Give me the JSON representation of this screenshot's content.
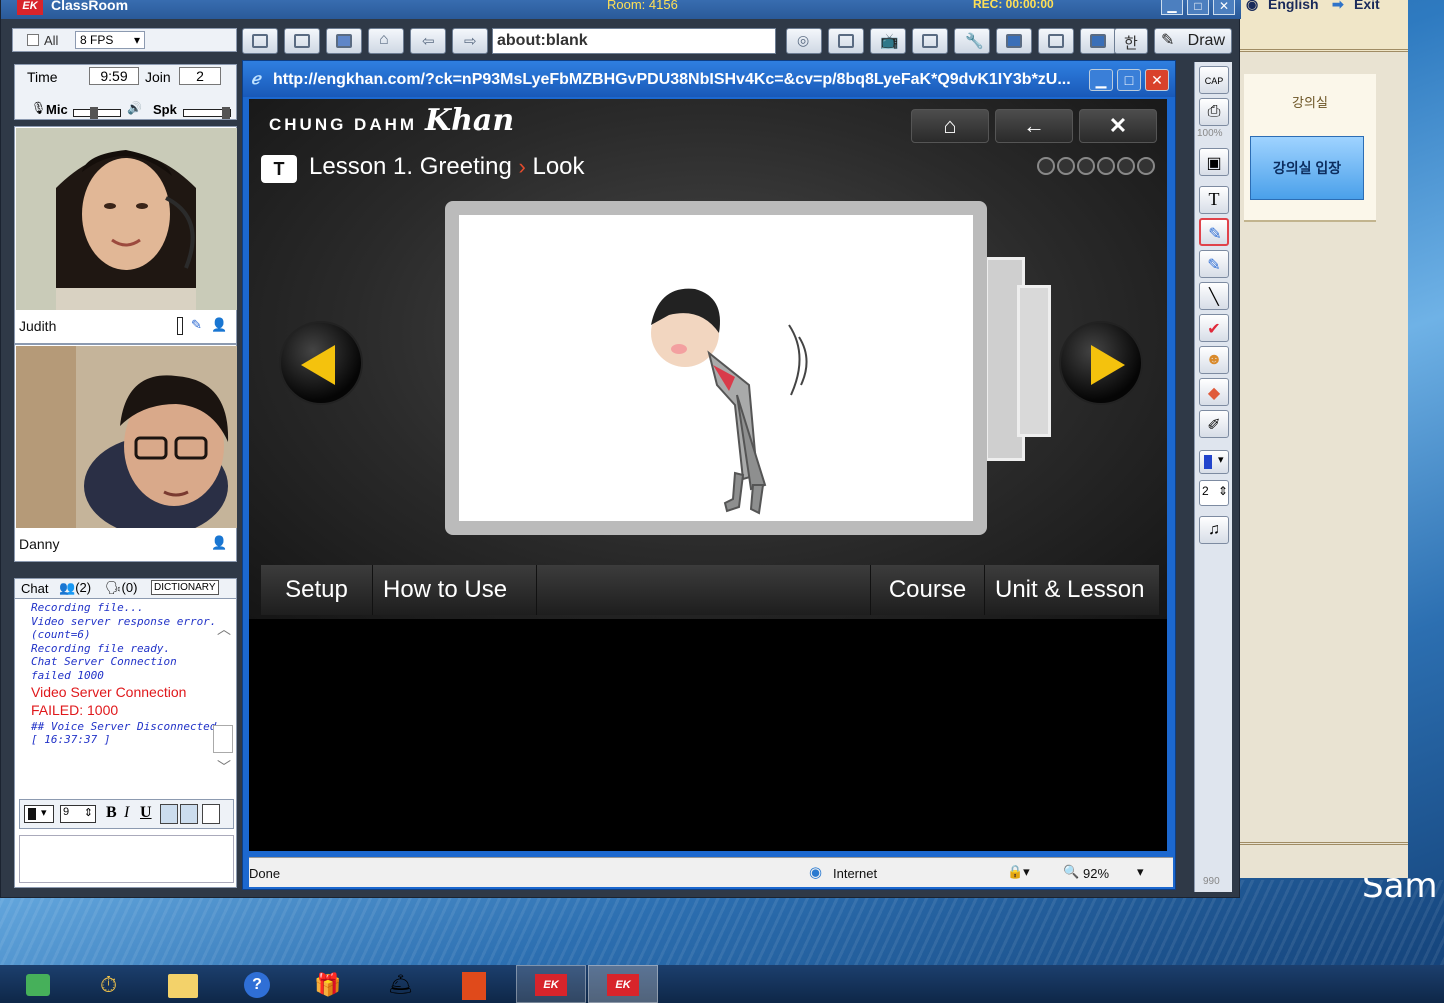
{
  "window": {
    "app_title": "ClassRoom",
    "room": "Room: 4156",
    "rec": "REC: 00:00:00",
    "app_logo": "EK"
  },
  "side_page": {
    "english_link": "English",
    "exit_link": "Exit",
    "panel_title": "강의실",
    "enter_button": "강의실 입장"
  },
  "desktop_text": "Sam",
  "controls": {
    "all_label": "All",
    "fps": "8 FPS",
    "time_label": "Time",
    "time_value": "9:59",
    "join_label": "Join",
    "join_value": "2",
    "mic_label": "Mic",
    "spk_label": "Spk"
  },
  "participants": [
    {
      "name": "Judith"
    },
    {
      "name": "Danny"
    }
  ],
  "chat": {
    "tab_chat": "Chat",
    "tab_users": "(2)",
    "tab_speakers": "(0)",
    "dictionary": "DICTIONARY",
    "log": [
      {
        "text": "Recording file...",
        "style": "mono"
      },
      {
        "text": "Video server response error.  (count=6)",
        "style": "mono"
      },
      {
        "text": "Recording file ready.",
        "style": "mono"
      },
      {
        "text": "Chat Server Connection failed 1000",
        "style": "mono"
      },
      {
        "text": "Video Server Connection FAILED: 1000",
        "style": "red"
      },
      {
        "text": "## Voice Server Disconnected [ 16:37:37 ]",
        "style": "mono"
      }
    ],
    "font_size": "9",
    "bold": "B",
    "italic": "I",
    "underline": "U"
  },
  "toolbar": {
    "address": "about:blank",
    "hangul": "한",
    "draw": "Draw"
  },
  "browser": {
    "url": "http://engkhan.com/?ck=nP93MsLyeFbMZBHGvPDU38NbISHv4Kc=&cv=p/8bq8LyeFaK*Q9dvK1IY3b*zU...",
    "brand": "CHUNG DAHM",
    "brand_script": "Khan",
    "lesson_badge": "T",
    "lesson": "Lesson 1. Greeting",
    "crumb": "Look",
    "menu": [
      "Setup",
      "How to Use",
      "Course",
      "Unit & Lesson"
    ],
    "status": "Done",
    "zone": "Internet",
    "zoom": "92%"
  },
  "palette": {
    "cap": "CAP",
    "zoom_pct": "100%",
    "line_width": "2",
    "counter": "990"
  },
  "colors": {
    "accent": "#ffe055",
    "error": "#e0181b",
    "log": "#2233c8",
    "arrow": "#f4c20d"
  }
}
